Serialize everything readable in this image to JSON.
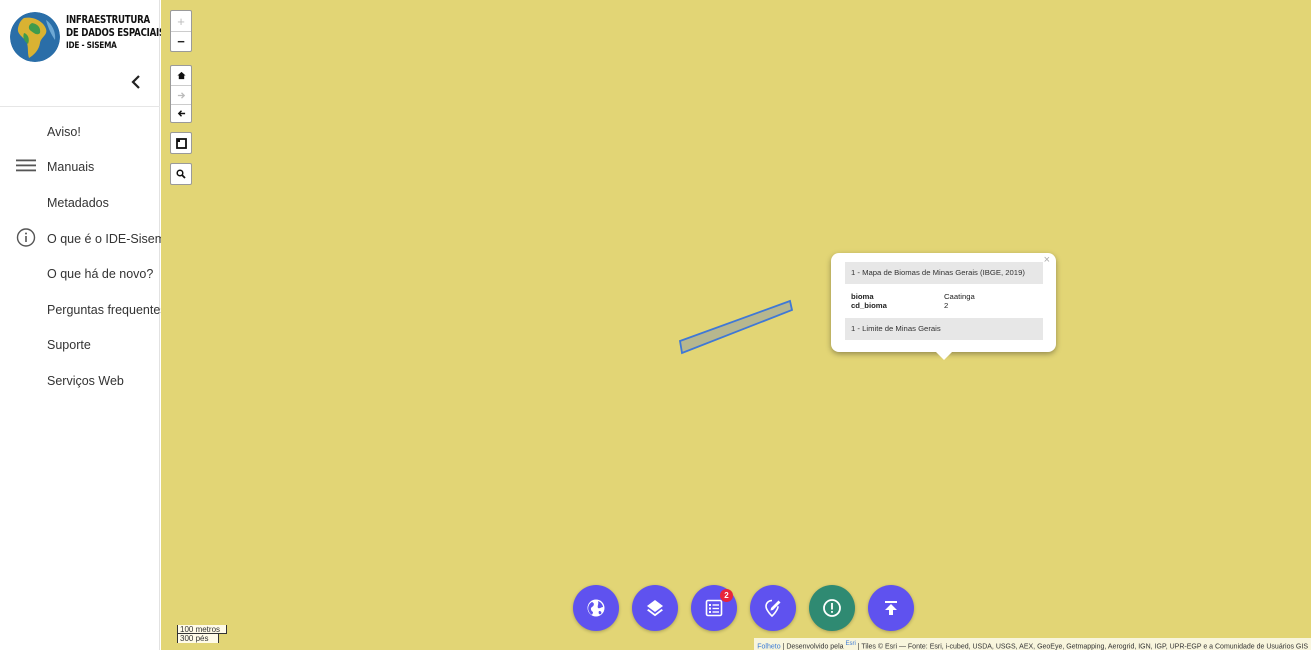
{
  "sidebar": {
    "title_lines": [
      "Infraestrutura",
      "de Dados Espaciais",
      "IDE - Sisema"
    ],
    "collapse_icon": "chevron-left-icon",
    "items": [
      {
        "label": "Aviso!",
        "icon": null
      },
      {
        "label": "Manuais",
        "icon": "hamburger-menu-icon"
      },
      {
        "label": "Metadados",
        "icon": null
      },
      {
        "label": "O que é o IDE-Sisema",
        "icon": "info-circle-icon"
      },
      {
        "label": "O que há de novo?",
        "icon": null
      },
      {
        "label": "Perguntas frequentes",
        "icon": null
      },
      {
        "label": "Suporte",
        "icon": null
      },
      {
        "label": "Serviços Web",
        "icon": null
      }
    ]
  },
  "map": {
    "background_color": "#e2d575",
    "zoom_controls": {
      "in": "+",
      "out": "−"
    },
    "history_controls": [
      "home-icon",
      "forward-arrow-icon",
      "back-arrow-icon"
    ],
    "scale": {
      "metric": "100 metros",
      "imperial": "300 pés"
    },
    "attribution": {
      "leaflet": "Folheto",
      "powered": " | Desenvolvido pela ",
      "esri": "Esri",
      "tiles": " | Tiles © Esri — Fonte: Esri, i-cubed, USDA, USGS, AEX, GeoEye, Getmapping, Aerogrid, IGN, IGP, UPR-EGP e a Comunidade de Usuários GIS"
    }
  },
  "popup": {
    "close": "×",
    "layer1_title": "1 - Mapa de Biomas de Minas Gerais (IBGE, 2019)",
    "attributes": [
      {
        "key": "bioma",
        "value": "Caatinga"
      },
      {
        "key": "cd_bioma",
        "value": "2"
      }
    ],
    "layer2_title": "1 - Limite de Minas Gerais"
  },
  "fabs": [
    {
      "icon": "globe-icon",
      "color": "#5f52ef"
    },
    {
      "icon": "layers-icon",
      "color": "#5f52ef"
    },
    {
      "icon": "list-icon",
      "color": "#5f52ef",
      "badge": "2"
    },
    {
      "icon": "edit-location-icon",
      "color": "#5f52ef"
    },
    {
      "icon": "alert-icon",
      "color": "#2f8a72"
    },
    {
      "icon": "upload-icon",
      "color": "#5f52ef"
    }
  ]
}
